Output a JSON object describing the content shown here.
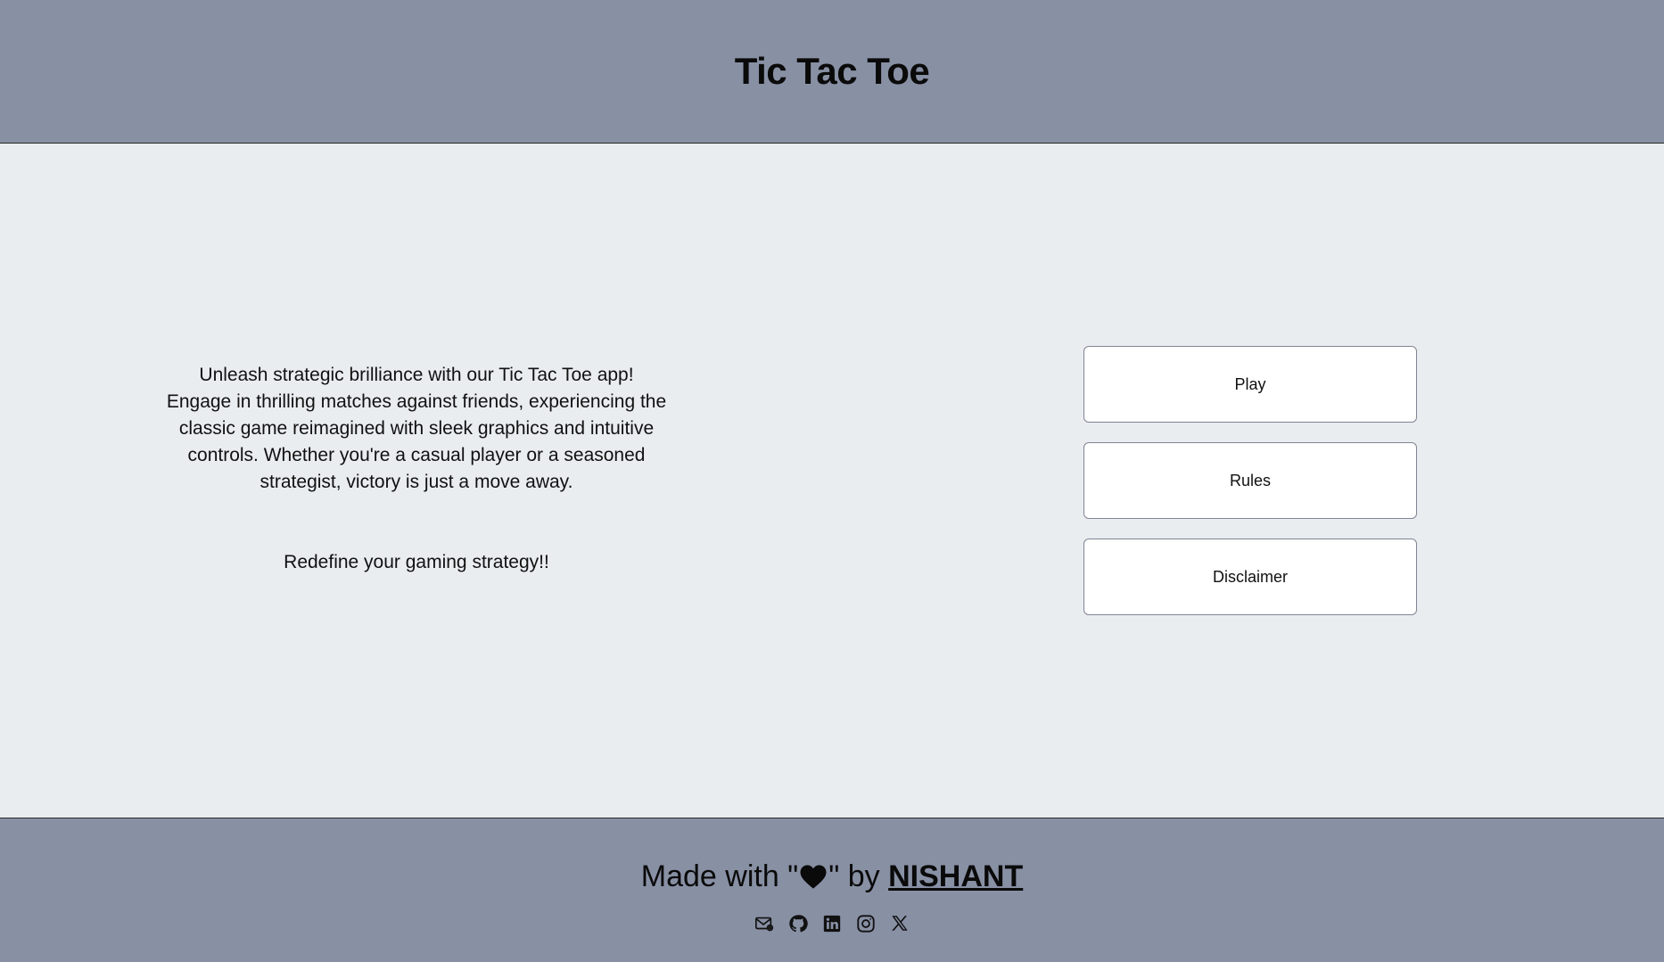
{
  "header": {
    "title": "Tic Tac Toe"
  },
  "intro": {
    "description": "Unleash strategic brilliance with our Tic Tac Toe app! Engage in thrilling matches against friends, experiencing the classic game reimagined with sleek graphics and intuitive controls. Whether you're a casual player or a seasoned strategist, victory is just a move away.",
    "tagline": "Redefine your gaming strategy!!"
  },
  "menu": {
    "play_label": "Play",
    "rules_label": "Rules",
    "disclaimer_label": "Disclaimer"
  },
  "footer": {
    "credit_prefix": "Made with \"",
    "credit_suffix": "\" by ",
    "author": "NISHANT",
    "socials": [
      "mail-icon",
      "github-icon",
      "linkedin-icon",
      "instagram-icon",
      "x-icon"
    ]
  },
  "colors": {
    "header_bg": "#8890a4",
    "main_bg": "#e9edf0",
    "button_bg": "#ffffff"
  }
}
